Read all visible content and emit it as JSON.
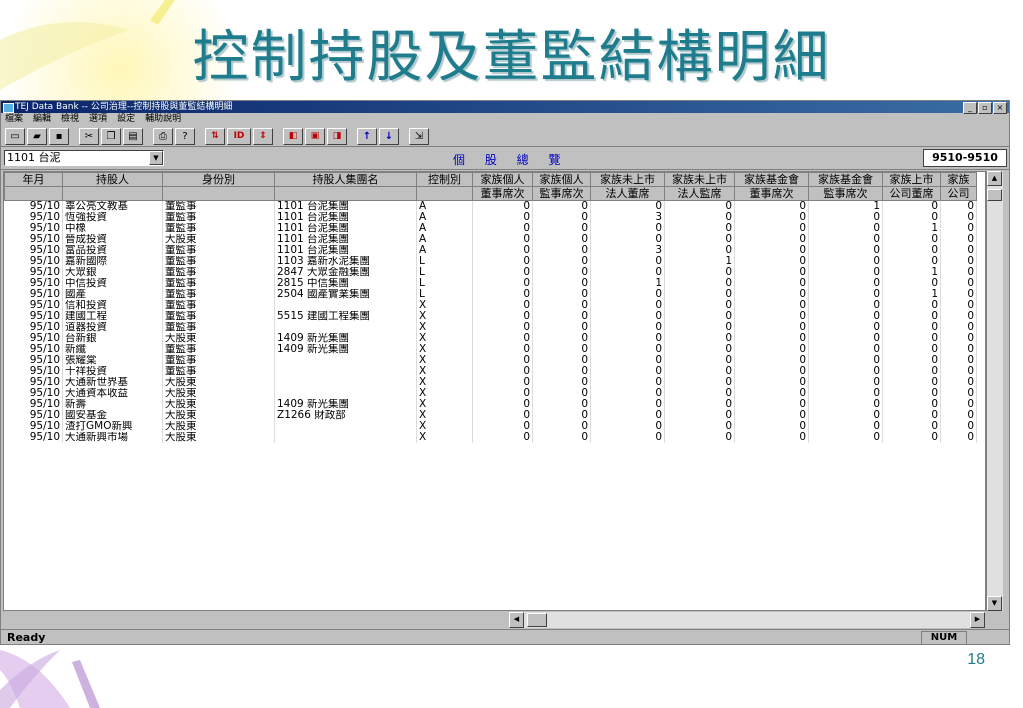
{
  "slide": {
    "title": "控制持股及董監結構明細",
    "page_number": "18"
  },
  "window": {
    "title": "TEJ Data Bank -- 公司治理--控制持股與董監結構明細",
    "buttons": [
      "_",
      "▫",
      "×"
    ]
  },
  "menu": [
    "檔案",
    "編輯",
    "檢視",
    "選項",
    "設定",
    "輔助說明"
  ],
  "toolbar": {
    "id_label": "ID"
  },
  "selector": {
    "company": "1101  台泥",
    "summary": "個 股 總 覽",
    "period": "9510-9510"
  },
  "table": {
    "headers": [
      "年月",
      "持股人",
      "身份別",
      "持股人集團名",
      "控制別",
      "家族個人",
      "家族個人",
      "家族未上市",
      "家族未上市",
      "家族基金會",
      "家族基金會",
      "家族上市",
      "家族"
    ],
    "subheaders": [
      "",
      "",
      "",
      "",
      "",
      "董事席次",
      "監事席次",
      "法人董席",
      "法人監席",
      "董事席次",
      "監事席次",
      "公司董席",
      "公司"
    ],
    "rows": [
      [
        "95/10",
        "辜公亮文教基",
        "董監事",
        "1101  台泥集團",
        "A",
        "0",
        "0",
        "0",
        "0",
        "0",
        "1",
        "0",
        "0"
      ],
      [
        "95/10",
        "恆強投資",
        "董監事",
        "1101  台泥集團",
        "A",
        "0",
        "0",
        "3",
        "0",
        "0",
        "0",
        "0",
        "0"
      ],
      [
        "95/10",
        "中橡",
        "董監事",
        "1101  台泥集團",
        "A",
        "0",
        "0",
        "0",
        "0",
        "0",
        "0",
        "1",
        "0"
      ],
      [
        "95/10",
        "晉成投資",
        "大股東",
        "1101  台泥集團",
        "A",
        "0",
        "0",
        "0",
        "0",
        "0",
        "0",
        "0",
        "0"
      ],
      [
        "95/10",
        "富品投資",
        "董監事",
        "1101  台泥集團",
        "A",
        "0",
        "0",
        "3",
        "0",
        "0",
        "0",
        "0",
        "0"
      ],
      [
        "95/10",
        "嘉新國際",
        "董監事",
        "1103  嘉新水泥集團",
        "L",
        "0",
        "0",
        "0",
        "1",
        "0",
        "0",
        "0",
        "0"
      ],
      [
        "95/10",
        "大眾銀",
        "董監事",
        "2847  大眾金融集團",
        "L",
        "0",
        "0",
        "0",
        "0",
        "0",
        "0",
        "1",
        "0"
      ],
      [
        "95/10",
        "中信投資",
        "董監事",
        "2815  中信集團",
        "L",
        "0",
        "0",
        "1",
        "0",
        "0",
        "0",
        "0",
        "0"
      ],
      [
        "95/10",
        "國產",
        "董監事",
        "2504  國產實業集團",
        "L",
        "0",
        "0",
        "0",
        "0",
        "0",
        "0",
        "1",
        "0"
      ],
      [
        "95/10",
        "信和投資",
        "董監事",
        "",
        "X",
        "0",
        "0",
        "0",
        "0",
        "0",
        "0",
        "0",
        "0"
      ],
      [
        "95/10",
        "建國工程",
        "董監事",
        "5515  建國工程集團",
        "X",
        "0",
        "0",
        "0",
        "0",
        "0",
        "0",
        "0",
        "0"
      ],
      [
        "95/10",
        "道器投資",
        "董監事",
        "",
        "X",
        "0",
        "0",
        "0",
        "0",
        "0",
        "0",
        "0",
        "0"
      ],
      [
        "95/10",
        "台新銀",
        "大股東",
        "1409  新光集團",
        "X",
        "0",
        "0",
        "0",
        "0",
        "0",
        "0",
        "0",
        "0"
      ],
      [
        "95/10",
        "新纖",
        "董監事",
        "1409  新光集團",
        "X",
        "0",
        "0",
        "0",
        "0",
        "0",
        "0",
        "0",
        "0"
      ],
      [
        "95/10",
        "張耀棠",
        "董監事",
        "",
        "X",
        "0",
        "0",
        "0",
        "0",
        "0",
        "0",
        "0",
        "0"
      ],
      [
        "95/10",
        "十祥投資",
        "董監事",
        "",
        "X",
        "0",
        "0",
        "0",
        "0",
        "0",
        "0",
        "0",
        "0"
      ],
      [
        "95/10",
        "大通新世界基",
        "大股東",
        "",
        "X",
        "0",
        "0",
        "0",
        "0",
        "0",
        "0",
        "0",
        "0"
      ],
      [
        "95/10",
        "大通資本收益",
        "大股東",
        "",
        "X",
        "0",
        "0",
        "0",
        "0",
        "0",
        "0",
        "0",
        "0"
      ],
      [
        "95/10",
        "新壽",
        "大股東",
        "1409  新光集團",
        "X",
        "0",
        "0",
        "0",
        "0",
        "0",
        "0",
        "0",
        "0"
      ],
      [
        "95/10",
        "國安基金",
        "大股東",
        "Z1266  財政部",
        "X",
        "0",
        "0",
        "0",
        "0",
        "0",
        "0",
        "0",
        "0"
      ],
      [
        "95/10",
        "渣打GMO新興",
        "大股東",
        "",
        "X",
        "0",
        "0",
        "0",
        "0",
        "0",
        "0",
        "0",
        "0"
      ],
      [
        "95/10",
        "大通新興市場",
        "大股東",
        "",
        "X",
        "0",
        "0",
        "0",
        "0",
        "0",
        "0",
        "0",
        "0"
      ]
    ]
  },
  "status": {
    "ready": "Ready",
    "num": "NUM"
  }
}
